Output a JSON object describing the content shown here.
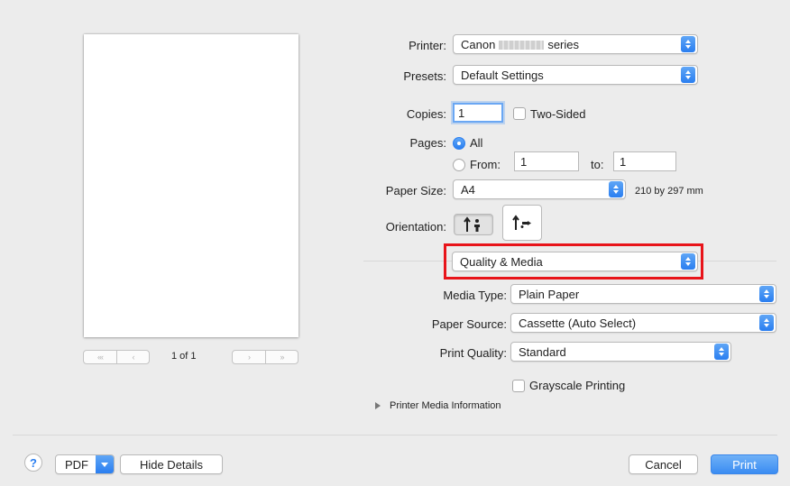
{
  "printer": {
    "label": "Printer:",
    "value_prefix": "Canon",
    "value_suffix": "series"
  },
  "presets": {
    "label": "Presets:",
    "value": "Default Settings"
  },
  "copies": {
    "label": "Copies:",
    "value": "1",
    "two_sided_label": "Two-Sided"
  },
  "pages": {
    "label": "Pages:",
    "all_label": "All",
    "from_label": "From:",
    "from_value": "1",
    "to_label": "to:",
    "to_value": "1"
  },
  "paper_size": {
    "label": "Paper Size:",
    "value": "A4",
    "dimensions": "210 by 297 mm"
  },
  "orientation": {
    "label": "Orientation:",
    "selected": "portrait"
  },
  "panel": {
    "value": "Quality & Media"
  },
  "media_type": {
    "label": "Media Type:",
    "value": "Plain Paper"
  },
  "paper_source": {
    "label": "Paper Source:",
    "value": "Cassette (Auto Select)"
  },
  "print_quality": {
    "label": "Print Quality:",
    "value": "Standard"
  },
  "grayscale": {
    "label": "Grayscale Printing"
  },
  "media_info": {
    "label": "Printer Media Information"
  },
  "preview": {
    "page_count": "1 of 1",
    "first_label": "«‹",
    "prev_label": "‹",
    "next_label": "›",
    "last_label": "››"
  },
  "footer": {
    "help_label": "?",
    "pdf_label": "PDF",
    "hide_details_label": "Hide Details",
    "cancel_label": "Cancel",
    "print_label": "Print"
  },
  "colors": {
    "accent": "#2a7ef0",
    "highlight_box": "#e8141a"
  }
}
